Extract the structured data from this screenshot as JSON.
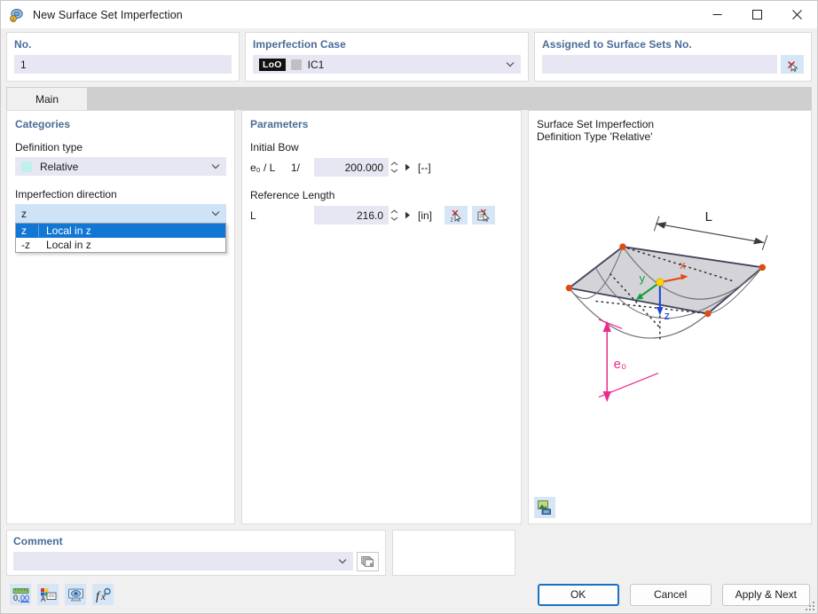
{
  "window": {
    "title": "New Surface Set Imperfection",
    "icon": "surface-imperfection-icon",
    "minimize_label": "—",
    "maximize_label": "☐",
    "close_label": "✕"
  },
  "top": {
    "no": {
      "title": "No.",
      "value": "1"
    },
    "imperfection_case": {
      "title": "Imperfection Case",
      "tag": "LoO",
      "value": "IC1"
    },
    "assigned": {
      "title": "Assigned to Surface Sets No.",
      "value": "",
      "pick_button_icon": "select-surface-sets-icon"
    }
  },
  "tabs": [
    {
      "label": "Main",
      "active": true
    }
  ],
  "categories": {
    "title": "Categories",
    "definition_type": {
      "label": "Definition type",
      "value": "Relative",
      "swatch": "#bdf0ee"
    },
    "imperfection_direction": {
      "label": "Imperfection direction",
      "value": "z",
      "open": true,
      "options": [
        {
          "key": "z",
          "text": "Local in z",
          "selected": true
        },
        {
          "key": "-z",
          "text": "Local in z",
          "selected": false
        }
      ]
    }
  },
  "parameters": {
    "title": "Parameters",
    "initial_bow": {
      "group_label": "Initial Bow",
      "symbol": "e₀ / L",
      "prefix": "1/",
      "value": "200.000",
      "unit": "[--]"
    },
    "reference_length": {
      "group_label": "Reference Length",
      "symbol": "L",
      "value": "216.0",
      "unit": "[in]",
      "button1_icon": "pick-length-2points-icon",
      "button2_icon": "pick-length-object-icon"
    }
  },
  "preview": {
    "line1": "Surface Set Imperfection",
    "line2": "Definition Type 'Relative'",
    "image_button_icon": "preview-image-icon",
    "diagram": {
      "length_label": "L",
      "bow_label": "e₀",
      "axis_x": "x",
      "axis_y": "y",
      "axis_z": "z",
      "colors": {
        "surface": "#d4d4d8",
        "edge": "#44445c",
        "node": "#e24a12",
        "origin": "#ffd400",
        "axis_x": "#e24a12",
        "axis_y": "#12a03c",
        "axis_z": "#1a46d8",
        "dimension": "#ec2a8e",
        "curve": "#6e6e78"
      }
    }
  },
  "comment": {
    "title": "Comment",
    "value": "",
    "picker_icon": "comment-templates-icon"
  },
  "footer": {
    "tools": [
      {
        "icon": "units-decimal-icon",
        "name": "units-button"
      },
      {
        "icon": "display-properties-icon",
        "name": "display-properties-button"
      },
      {
        "icon": "visibility-icon",
        "name": "visibility-button"
      },
      {
        "icon": "formula-fx-icon",
        "name": "formula-button"
      }
    ],
    "buttons": {
      "ok": "OK",
      "cancel": "Cancel",
      "apply_next": "Apply & Next"
    }
  },
  "colors": {
    "accent_blue": "#1277d4",
    "group_title": "#4a6b9a",
    "field_bg": "#e6e7f2",
    "focus_bg": "#cfe3f7",
    "icon_btn_bg": "#d6e6f7"
  }
}
